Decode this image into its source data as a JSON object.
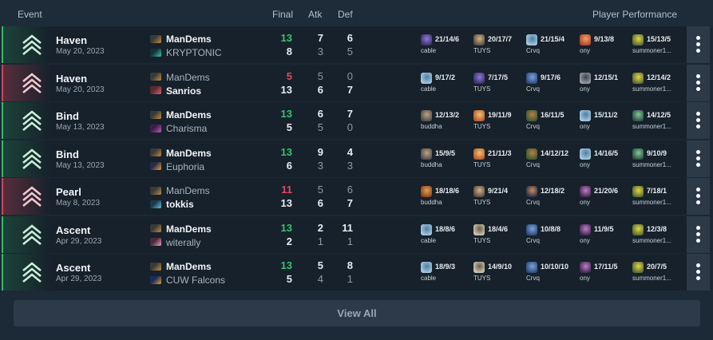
{
  "header": {
    "event": "Event",
    "final": "Final",
    "atk": "Atk",
    "def": "Def",
    "performance": "Player Performance"
  },
  "view_all": "View All",
  "colors": {
    "win": "#35b86a",
    "loss": "#d0445a",
    "win_score": "#39c16c",
    "loss_score": "#e0485d"
  },
  "matches": [
    {
      "result": "win",
      "map": "Haven",
      "date": "May 20, 2023",
      "team1": {
        "name": "ManDems",
        "icon": "mandems-logo",
        "final": "13",
        "atk": "7",
        "def": "6"
      },
      "team2": {
        "name": "KRYPTONIC",
        "icon": "kryptonic-logo",
        "final": "8",
        "atk": "3",
        "def": "5"
      },
      "players": [
        {
          "kda": "21/14/6",
          "name": "cable",
          "agent": "omen"
        },
        {
          "kda": "20/17/7",
          "name": "TUYS",
          "agent": "kayo"
        },
        {
          "kda": "21/15/4",
          "name": "Crvq",
          "agent": "sage"
        },
        {
          "kda": "9/13/8",
          "name": "ony",
          "agent": "phoenix"
        },
        {
          "kda": "15/13/5",
          "name": "summoner1...",
          "agent": "killjoy"
        }
      ]
    },
    {
      "result": "loss",
      "map": "Haven",
      "date": "May 20, 2023",
      "team1": {
        "name": "ManDems",
        "icon": "mandems-logo",
        "final": "5",
        "atk": "5",
        "def": "0"
      },
      "team2": {
        "name": "Sanrios",
        "icon": "sanrios-logo",
        "final": "13",
        "atk": "6",
        "def": "7"
      },
      "players": [
        {
          "kda": "9/17/2",
          "name": "cable",
          "agent": "sage"
        },
        {
          "kda": "7/17/5",
          "name": "TUYS",
          "agent": "omen"
        },
        {
          "kda": "9/17/6",
          "name": "Crvq",
          "agent": "sova"
        },
        {
          "kda": "12/15/1",
          "name": "ony",
          "agent": "cypher"
        },
        {
          "kda": "12/14/2",
          "name": "summoner1...",
          "agent": "killjoy"
        }
      ]
    },
    {
      "result": "win",
      "map": "Bind",
      "date": "May 13, 2023",
      "team1": {
        "name": "ManDems",
        "icon": "mandems-logo",
        "final": "13",
        "atk": "6",
        "def": "7"
      },
      "team2": {
        "name": "Charisma",
        "icon": "charisma-logo",
        "final": "5",
        "atk": "5",
        "def": "0"
      },
      "players": [
        {
          "kda": "12/13/2",
          "name": "buddha",
          "agent": "brimstone"
        },
        {
          "kda": "19/11/9",
          "name": "TUYS",
          "agent": "raze"
        },
        {
          "kda": "16/11/5",
          "name": "Crvq",
          "agent": "skye"
        },
        {
          "kda": "15/11/2",
          "name": "ony",
          "agent": "sage"
        },
        {
          "kda": "14/12/5",
          "name": "summoner1...",
          "agent": "viper"
        }
      ]
    },
    {
      "result": "win",
      "map": "Bind",
      "date": "May 13, 2023",
      "team1": {
        "name": "ManDems",
        "icon": "mandems-logo",
        "final": "13",
        "atk": "9",
        "def": "4"
      },
      "team2": {
        "name": "Euphoria",
        "icon": "euphoria-logo",
        "final": "6",
        "atk": "3",
        "def": "3"
      },
      "players": [
        {
          "kda": "15/9/5",
          "name": "buddha",
          "agent": "brimstone"
        },
        {
          "kda": "21/11/3",
          "name": "TUYS",
          "agent": "raze"
        },
        {
          "kda": "14/12/12",
          "name": "Crvq",
          "agent": "skye"
        },
        {
          "kda": "14/16/5",
          "name": "ony",
          "agent": "sage"
        },
        {
          "kda": "9/10/9",
          "name": "summoner1...",
          "agent": "viper"
        }
      ]
    },
    {
      "result": "loss",
      "map": "Pearl",
      "date": "May 8, 2023",
      "team1": {
        "name": "ManDems",
        "icon": "mandems-logo",
        "final": "11",
        "atk": "5",
        "def": "6"
      },
      "team2": {
        "name": "tokkis",
        "icon": "tokkis-logo",
        "final": "13",
        "atk": "6",
        "def": "7"
      },
      "players": [
        {
          "kda": "18/18/6",
          "name": "buddha",
          "agent": "breach"
        },
        {
          "kda": "9/21/4",
          "name": "TUYS",
          "agent": "kayo"
        },
        {
          "kda": "12/18/2",
          "name": "Crvq",
          "agent": "fade"
        },
        {
          "kda": "21/20/6",
          "name": "ony",
          "agent": "reyna"
        },
        {
          "kda": "7/18/1",
          "name": "summoner1...",
          "agent": "killjoy"
        }
      ]
    },
    {
      "result": "win",
      "map": "Ascent",
      "date": "Apr 29, 2023",
      "team1": {
        "name": "ManDems",
        "icon": "mandems-logo",
        "final": "13",
        "atk": "2",
        "def": "11"
      },
      "team2": {
        "name": "witerally",
        "icon": "witerally-logo",
        "final": "2",
        "atk": "1",
        "def": "1"
      },
      "players": [
        {
          "kda": "18/8/6",
          "name": "cable",
          "agent": "sage"
        },
        {
          "kda": "18/4/6",
          "name": "TUYS",
          "agent": "chamber"
        },
        {
          "kda": "10/8/8",
          "name": "Crvq",
          "agent": "sova"
        },
        {
          "kda": "11/9/5",
          "name": "ony",
          "agent": "reyna"
        },
        {
          "kda": "12/3/8",
          "name": "summoner1...",
          "agent": "killjoy"
        }
      ]
    },
    {
      "result": "win",
      "map": "Ascent",
      "date": "Apr 29, 2023",
      "team1": {
        "name": "ManDems",
        "icon": "mandems-logo",
        "final": "13",
        "atk": "5",
        "def": "8"
      },
      "team2": {
        "name": "CUW Falcons",
        "icon": "cuw-falcons-logo",
        "final": "5",
        "atk": "4",
        "def": "1"
      },
      "players": [
        {
          "kda": "18/9/3",
          "name": "cable",
          "agent": "sage"
        },
        {
          "kda": "14/9/10",
          "name": "TUYS",
          "agent": "chamber"
        },
        {
          "kda": "10/10/10",
          "name": "Crvq",
          "agent": "sova"
        },
        {
          "kda": "17/11/5",
          "name": "ony",
          "agent": "reyna"
        },
        {
          "kda": "20/7/5",
          "name": "summoner1...",
          "agent": "killjoy"
        }
      ]
    }
  ]
}
